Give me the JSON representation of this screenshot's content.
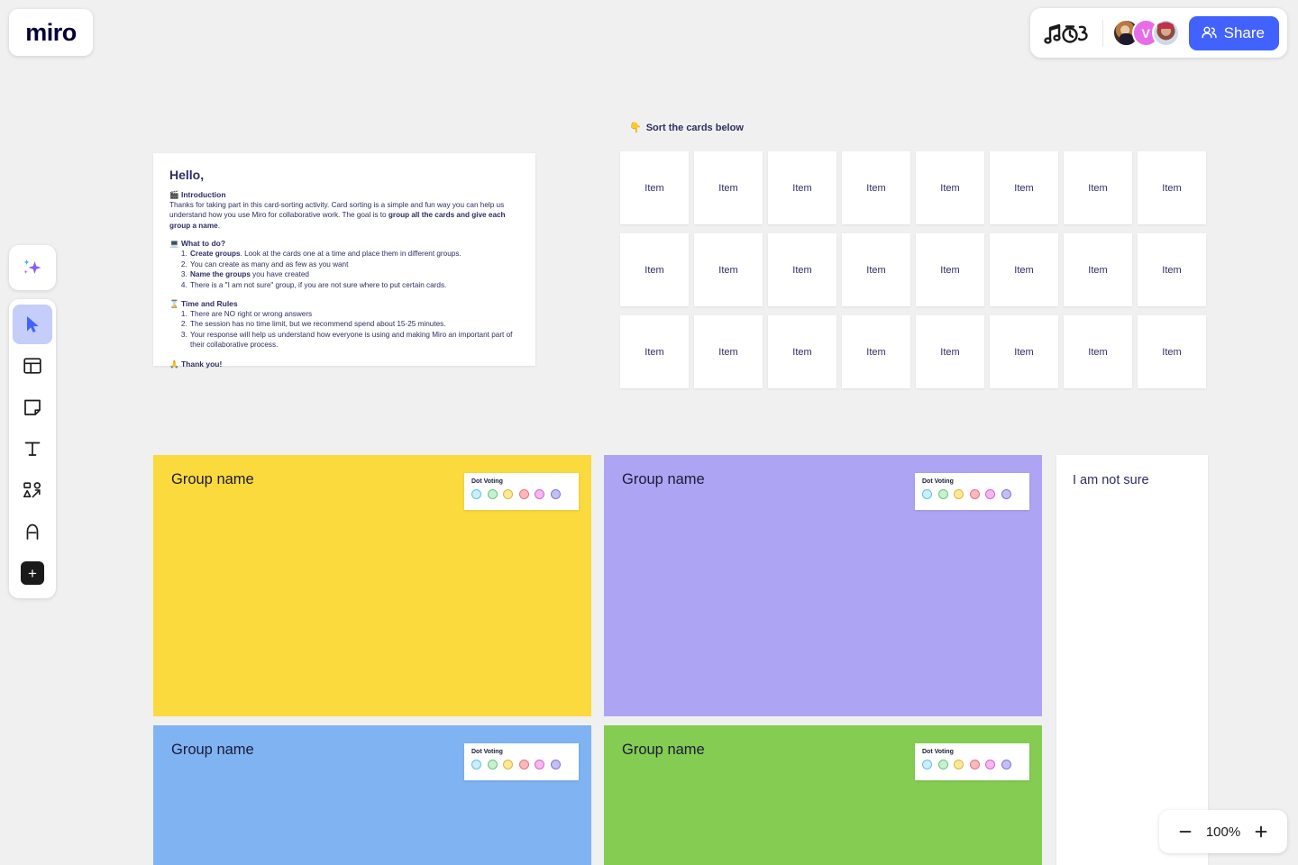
{
  "app": {
    "logo_text": "miro",
    "background_color": "#f0f0f0"
  },
  "topbar": {
    "doodle_icon": "music-notes-timer-doodle",
    "avatars": [
      {
        "type": "photo",
        "name": "collaborator-1"
      },
      {
        "type": "initial",
        "initial": "V",
        "color": "#e86ce8"
      },
      {
        "type": "photo",
        "name": "collaborator-3"
      }
    ],
    "share_label": "Share",
    "share_color": "#4262ff"
  },
  "toolbar": {
    "ai_icon": "ai-sparkle-icon",
    "tools": [
      {
        "icon": "cursor-select-icon",
        "label": "Select",
        "active": true
      },
      {
        "icon": "templates-icon",
        "label": "Templates",
        "active": false
      },
      {
        "icon": "sticky-note-icon",
        "label": "Sticky note",
        "active": false
      },
      {
        "icon": "text-icon",
        "label": "Text",
        "active": false
      },
      {
        "icon": "shapes-connector-icon",
        "label": "Shapes and connectors",
        "active": false
      },
      {
        "icon": "pen-icon",
        "label": "Pen",
        "active": false
      }
    ],
    "more_label": "+"
  },
  "instructions": {
    "title": "Hello,",
    "sections": [
      {
        "emoji": "🎬",
        "heading": "Introduction",
        "body_1": "Thanks for taking part in this card-sorting activity. Card sorting is a simple and fun way you can help us understand how you use Miro for collaborative work. The goal is to ",
        "body_bold": "group all the cards and give each group a name",
        "body_2": "."
      },
      {
        "emoji": "💻",
        "heading": "What to do?",
        "items": [
          {
            "bold": "Create groups",
            "rest": ". Look at the cards one at a time and place them in different groups."
          },
          {
            "bold": "",
            "rest": "You can create as many and as few as you want"
          },
          {
            "bold": "Name the groups",
            "rest": " you have created"
          },
          {
            "bold": "",
            "rest": "There is a \"I am not sure\" group, if you are not sure where to put certain cards."
          }
        ]
      },
      {
        "emoji": "⌛",
        "heading": "Time and Rules",
        "items": [
          {
            "bold": "",
            "rest": "There are NO right or wrong answers"
          },
          {
            "bold": "",
            "rest": "The session has no time limit, but we recommend spend about 15-25 minutes."
          },
          {
            "bold": "",
            "rest": "Your response will help us understand how everyone is using and making Miro an important part of their collaborative process."
          }
        ]
      }
    ],
    "thanks_emoji": "🙏",
    "thanks": "Thank you!"
  },
  "sort_section": {
    "emoji": "👇",
    "heading": "Sort the cards below",
    "card_label": "Item",
    "rows": 3,
    "columns": 8,
    "total_cards": 24
  },
  "dot_voting": {
    "label": "Dot Voting",
    "dots": [
      {
        "name": "blue-dot",
        "fill": "#cdeefb",
        "border": "#5fc2e8"
      },
      {
        "name": "green-dot",
        "fill": "#c8f0cf",
        "border": "#63c97c"
      },
      {
        "name": "yellow-dot",
        "fill": "#fbe89a",
        "border": "#d6b93c"
      },
      {
        "name": "red-dot",
        "fill": "#f9b9bd",
        "border": "#e8737f"
      },
      {
        "name": "pink-dot",
        "fill": "#f4b8f0",
        "border": "#d964d2"
      },
      {
        "name": "purple-dot",
        "fill": "#c3c0f2",
        "border": "#7d77e0"
      }
    ]
  },
  "groups": [
    {
      "title": "Group name",
      "color": "#fada3c",
      "has_dot_voting": true
    },
    {
      "title": "Group name",
      "color": "#aea4f4",
      "has_dot_voting": true
    },
    {
      "title": "Group name",
      "color": "#7fb3f2",
      "has_dot_voting": true
    },
    {
      "title": "Group name",
      "color": "#84cc52",
      "has_dot_voting": true
    }
  ],
  "not_sure_card": {
    "title": "I am not sure"
  },
  "zoom_control": {
    "zoom_out_label": "−",
    "value": "100%",
    "zoom_in_label": "+"
  }
}
